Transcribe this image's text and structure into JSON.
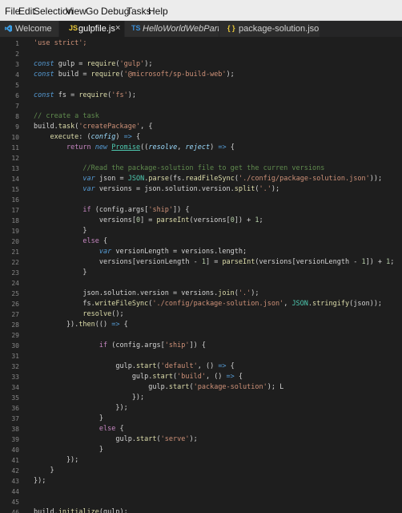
{
  "menu": [
    "File",
    "Edit",
    "Selection",
    "View",
    "Go",
    "Debug",
    "Tasks",
    "Help"
  ],
  "tabs": [
    {
      "icon": "vs-icon",
      "badge": "",
      "label": "Welcome",
      "active": false
    },
    {
      "icon": "js-file-icon",
      "badge": "JS",
      "label": "gulpfile.js",
      "active": true,
      "close": "×"
    },
    {
      "icon": "ts-file-icon",
      "badge": "TS",
      "label": "HelloWorldWebPart.ts",
      "active": false
    },
    {
      "icon": "json-file-icon",
      "badge": "{ }",
      "label": "package-solution.json",
      "active": false
    }
  ],
  "colors": {
    "editor_bg": "#1e1e1e",
    "keyword": "#569cd6",
    "control_keyword": "#c586c0",
    "function": "#dcdcaa",
    "string": "#ce9178",
    "comment": "#608b4e",
    "number": "#b5cea8",
    "parameter": "#9cdcfe",
    "class": "#4ec9b0"
  },
  "editor": {
    "cursor_line": 47,
    "lines": [
      [
        [
          "'use strict';",
          "str"
        ]
      ],
      [],
      [
        [
          "const",
          "kw"
        ],
        [
          " gulp = ",
          ""
        ],
        [
          "require",
          "fn"
        ],
        [
          "(",
          ""
        ],
        [
          "'gulp'",
          "str"
        ],
        [
          ");",
          ""
        ]
      ],
      [
        [
          "const",
          "kw"
        ],
        [
          " build = ",
          ""
        ],
        [
          "require",
          "fn"
        ],
        [
          "(",
          ""
        ],
        [
          "'@microsoft/sp-build-web'",
          "str"
        ],
        [
          ");",
          ""
        ]
      ],
      [],
      [
        [
          "const",
          "kw"
        ],
        [
          " fs = ",
          ""
        ],
        [
          "require",
          "fn"
        ],
        [
          "(",
          ""
        ],
        [
          "'fs'",
          "str"
        ],
        [
          ");",
          ""
        ]
      ],
      [],
      [
        [
          "// create a task",
          "com"
        ]
      ],
      [
        [
          "build.",
          ""
        ],
        [
          "task",
          "fn"
        ],
        [
          "(",
          ""
        ],
        [
          "'createPackage'",
          "str"
        ],
        [
          ", {",
          ""
        ]
      ],
      [
        [
          "    execute",
          "fn"
        ],
        [
          ": (",
          ""
        ],
        [
          "config",
          "prm"
        ],
        [
          ") ",
          ""
        ],
        [
          "=>",
          "kw"
        ],
        [
          " {",
          ""
        ]
      ],
      [
        [
          "        ",
          ""
        ],
        [
          "return",
          "kw2"
        ],
        [
          " ",
          ""
        ],
        [
          "new",
          "kw"
        ],
        [
          " ",
          ""
        ],
        [
          "Promise",
          "cls ul"
        ],
        [
          "((",
          ""
        ],
        [
          "resolve",
          "prm"
        ],
        [
          ", ",
          ""
        ],
        [
          "reject",
          "prm"
        ],
        [
          ") ",
          ""
        ],
        [
          "=>",
          "kw"
        ],
        [
          " {",
          ""
        ]
      ],
      [],
      [
        [
          "            ",
          ""
        ],
        [
          "//Read the package-solution file to get the curren versions",
          "com"
        ]
      ],
      [
        [
          "            ",
          ""
        ],
        [
          "var",
          "kw"
        ],
        [
          " json = ",
          ""
        ],
        [
          "JSON",
          "cls"
        ],
        [
          ".",
          ""
        ],
        [
          "parse",
          "fn"
        ],
        [
          "(fs.",
          ""
        ],
        [
          "readFileSync",
          "fn"
        ],
        [
          "(",
          ""
        ],
        [
          "'./config/package-solution.json'",
          "str"
        ],
        [
          "));",
          ""
        ]
      ],
      [
        [
          "            ",
          ""
        ],
        [
          "var",
          "kw"
        ],
        [
          " versions = json.solution.version.",
          ""
        ],
        [
          "split",
          "fn"
        ],
        [
          "(",
          ""
        ],
        [
          "'.'",
          "str"
        ],
        [
          ");",
          ""
        ]
      ],
      [],
      [
        [
          "            ",
          ""
        ],
        [
          "if",
          "kw2"
        ],
        [
          " (config.args[",
          ""
        ],
        [
          "'ship'",
          "str"
        ],
        [
          "]) {",
          ""
        ]
      ],
      [
        [
          "                versions[",
          ""
        ],
        [
          "0",
          "num"
        ],
        [
          "] = ",
          ""
        ],
        [
          "parseInt",
          "fn"
        ],
        [
          "(versions[",
          ""
        ],
        [
          "0",
          "num"
        ],
        [
          "]) + ",
          ""
        ],
        [
          "1",
          "num"
        ],
        [
          ";",
          ""
        ]
      ],
      [
        [
          "            }",
          ""
        ]
      ],
      [
        [
          "            ",
          ""
        ],
        [
          "else",
          "kw2"
        ],
        [
          " {",
          ""
        ]
      ],
      [
        [
          "                ",
          ""
        ],
        [
          "var",
          "kw"
        ],
        [
          " versionLength = versions.length;",
          ""
        ]
      ],
      [
        [
          "                versions[versionLength - ",
          ""
        ],
        [
          "1",
          "num"
        ],
        [
          "] = ",
          ""
        ],
        [
          "parseInt",
          "fn"
        ],
        [
          "(versions[versionLength - ",
          ""
        ],
        [
          "1",
          "num"
        ],
        [
          "]) + ",
          ""
        ],
        [
          "1",
          "num"
        ],
        [
          ";",
          ""
        ]
      ],
      [
        [
          "            }",
          ""
        ]
      ],
      [],
      [
        [
          "            json.solution.version = versions.",
          ""
        ],
        [
          "join",
          "fn"
        ],
        [
          "(",
          ""
        ],
        [
          "'.'",
          "str"
        ],
        [
          ");",
          ""
        ]
      ],
      [
        [
          "            fs.",
          ""
        ],
        [
          "writeFileSync",
          "fn"
        ],
        [
          "(",
          ""
        ],
        [
          "'./config/package-solution.json'",
          "str"
        ],
        [
          ", ",
          ""
        ],
        [
          "JSON",
          "cls"
        ],
        [
          ".",
          ""
        ],
        [
          "stringify",
          "fn"
        ],
        [
          "(json));",
          ""
        ]
      ],
      [
        [
          "            ",
          ""
        ],
        [
          "resolve",
          "fn"
        ],
        [
          "();",
          ""
        ]
      ],
      [
        [
          "        }).",
          ""
        ],
        [
          "then",
          "fn"
        ],
        [
          "(() ",
          ""
        ],
        [
          "=>",
          "kw"
        ],
        [
          " {",
          ""
        ]
      ],
      [],
      [
        [
          "                ",
          ""
        ],
        [
          "if",
          "kw2"
        ],
        [
          " (config.args[",
          ""
        ],
        [
          "'ship'",
          "str"
        ],
        [
          "]) {",
          ""
        ]
      ],
      [],
      [
        [
          "                    gulp.",
          ""
        ],
        [
          "start",
          "fn"
        ],
        [
          "(",
          ""
        ],
        [
          "'default'",
          "str"
        ],
        [
          ", () ",
          ""
        ],
        [
          "=>",
          "kw"
        ],
        [
          " {",
          ""
        ]
      ],
      [
        [
          "                        gulp.",
          ""
        ],
        [
          "start",
          "fn"
        ],
        [
          "(",
          ""
        ],
        [
          "'build'",
          "str"
        ],
        [
          ", () ",
          ""
        ],
        [
          "=>",
          "kw"
        ],
        [
          " {",
          ""
        ]
      ],
      [
        [
          "                            gulp.",
          ""
        ],
        [
          "start",
          "fn"
        ],
        [
          "(",
          ""
        ],
        [
          "'package-solution'",
          "str"
        ],
        [
          "); L",
          ""
        ]
      ],
      [
        [
          "                        });",
          ""
        ]
      ],
      [
        [
          "                    });",
          ""
        ]
      ],
      [
        [
          "                }",
          ""
        ]
      ],
      [
        [
          "                ",
          ""
        ],
        [
          "else",
          "kw2"
        ],
        [
          " {",
          ""
        ]
      ],
      [
        [
          "                    gulp.",
          ""
        ],
        [
          "start",
          "fn"
        ],
        [
          "(",
          ""
        ],
        [
          "'serve'",
          "str"
        ],
        [
          ");",
          ""
        ]
      ],
      [
        [
          "                }",
          ""
        ]
      ],
      [
        [
          "        });",
          ""
        ]
      ],
      [
        [
          "    }",
          ""
        ]
      ],
      [
        [
          "});",
          ""
        ]
      ],
      [],
      [],
      [
        [
          "build.",
          ""
        ],
        [
          "initialize",
          "fn"
        ],
        [
          "(gulp);",
          ""
        ]
      ],
      []
    ]
  }
}
